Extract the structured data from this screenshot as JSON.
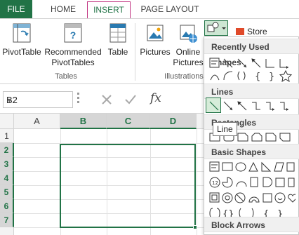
{
  "tabs": {
    "file": "FILE",
    "home": "HOME",
    "insert": "INSERT",
    "page_layout": "PAGE LAYOUT"
  },
  "ribbon": {
    "pivot_table": "PivotTable",
    "recommended_line1": "Recommended",
    "recommended_line2": "PivotTables",
    "table": "Table",
    "tables_group": "Tables",
    "pictures": "Pictures",
    "online_line1": "Online",
    "online_line2": "Pictures",
    "illustrations_group": "Illustrations",
    "store": "Store"
  },
  "formula_bar": {
    "name_box": "B2",
    "fx": "fx"
  },
  "grid": {
    "columns": [
      "A",
      "B",
      "C",
      "D"
    ],
    "selected_columns": [
      "B",
      "C",
      "D"
    ],
    "rows": [
      "1",
      "2",
      "3",
      "4",
      "5",
      "6",
      "7"
    ],
    "selected_rows": [
      "2",
      "3",
      "4",
      "5",
      "6",
      "7"
    ]
  },
  "shapes_menu": {
    "recently_used": "Recently Used Shapes",
    "lines": "Lines",
    "rectangles": "Rectangles",
    "basic_shapes": "Basic Shapes",
    "block_arrows": "Block Arrows",
    "tooltip": "Line"
  },
  "colors": {
    "accent": "#217346",
    "insert_tab_border": "#c0307f"
  }
}
